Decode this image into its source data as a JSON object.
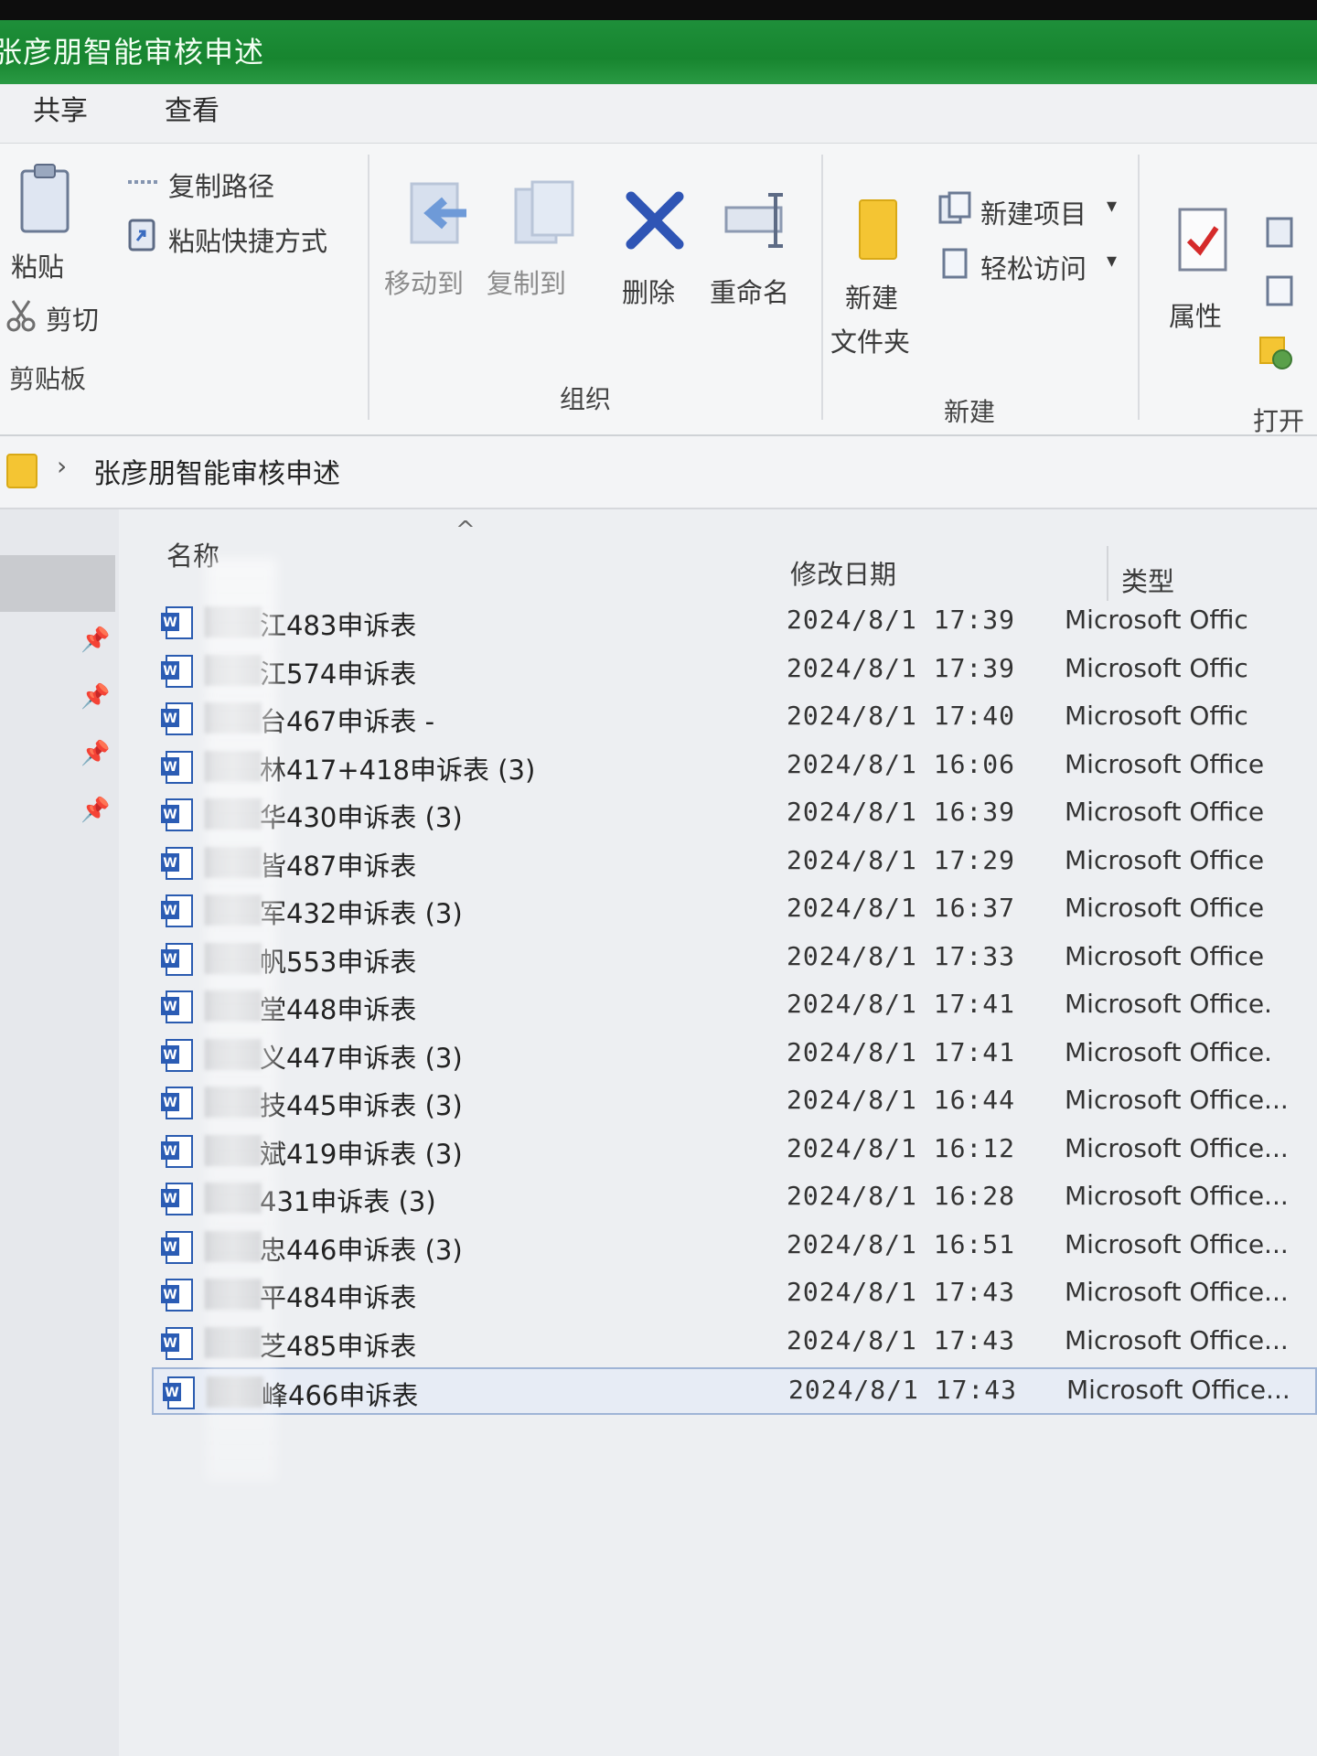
{
  "window": {
    "title": "张彦朋智能审核申述"
  },
  "tabs": [
    {
      "label": "共享"
    },
    {
      "label": "查看"
    }
  ],
  "ribbon": {
    "clipboard": {
      "paste": "粘贴",
      "cut": "剪切",
      "copy_path": "复制路径",
      "paste_shortcut": "粘贴快捷方式",
      "group": "剪贴板"
    },
    "organize": {
      "move_to": "移动到",
      "copy_to": "复制到",
      "delete": "删除",
      "rename": "重命名",
      "group": "组织"
    },
    "new": {
      "new_folder_line1": "新建",
      "new_folder_line2": "文件夹",
      "new_item": "新建项目",
      "easy_access": "轻松访问",
      "group": "新建"
    },
    "open": {
      "properties": "属性",
      "group": "打开"
    }
  },
  "address": {
    "crumb": "张彦朋智能审核申述"
  },
  "columns": {
    "name": "名称",
    "date": "修改日期",
    "type": "类型"
  },
  "files": [
    {
      "name": "江483申诉表",
      "date": "2024/8/1 17:39",
      "type": "Microsoft Offic"
    },
    {
      "name": "江574申诉表",
      "date": "2024/8/1 17:39",
      "type": "Microsoft Offic"
    },
    {
      "name": "台467申诉表 -",
      "date": "2024/8/1 17:40",
      "type": "Microsoft Offic"
    },
    {
      "name": "林417+418申诉表 (3)",
      "date": "2024/8/1 16:06",
      "type": "Microsoft Office"
    },
    {
      "name": "华430申诉表 (3)",
      "date": "2024/8/1 16:39",
      "type": "Microsoft Office"
    },
    {
      "name": "皆487申诉表",
      "date": "2024/8/1 17:29",
      "type": "Microsoft Office"
    },
    {
      "name": "军432申诉表 (3)",
      "date": "2024/8/1 16:37",
      "type": "Microsoft Office"
    },
    {
      "name": "帆553申诉表",
      "date": "2024/8/1 17:33",
      "type": "Microsoft Office"
    },
    {
      "name": "堂448申诉表",
      "date": "2024/8/1 17:41",
      "type": "Microsoft Office."
    },
    {
      "name": "义447申诉表 (3)",
      "date": "2024/8/1 17:41",
      "type": "Microsoft Office."
    },
    {
      "name": "技445申诉表 (3)",
      "date": "2024/8/1 16:44",
      "type": "Microsoft Office..."
    },
    {
      "name": "斌419申诉表 (3)",
      "date": "2024/8/1 16:12",
      "type": "Microsoft Office..."
    },
    {
      "name": "431申诉表 (3)",
      "date": "2024/8/1 16:28",
      "type": "Microsoft Office..."
    },
    {
      "name": "忠446申诉表 (3)",
      "date": "2024/8/1 16:51",
      "type": "Microsoft Office..."
    },
    {
      "name": "平484申诉表",
      "date": "2024/8/1 17:43",
      "type": "Microsoft Office..."
    },
    {
      "name": "芝485申诉表",
      "date": "2024/8/1 17:43",
      "type": "Microsoft Office..."
    },
    {
      "name": "峰466申诉表",
      "date": "2024/8/1 17:43",
      "type": "Microsoft Office..."
    }
  ]
}
